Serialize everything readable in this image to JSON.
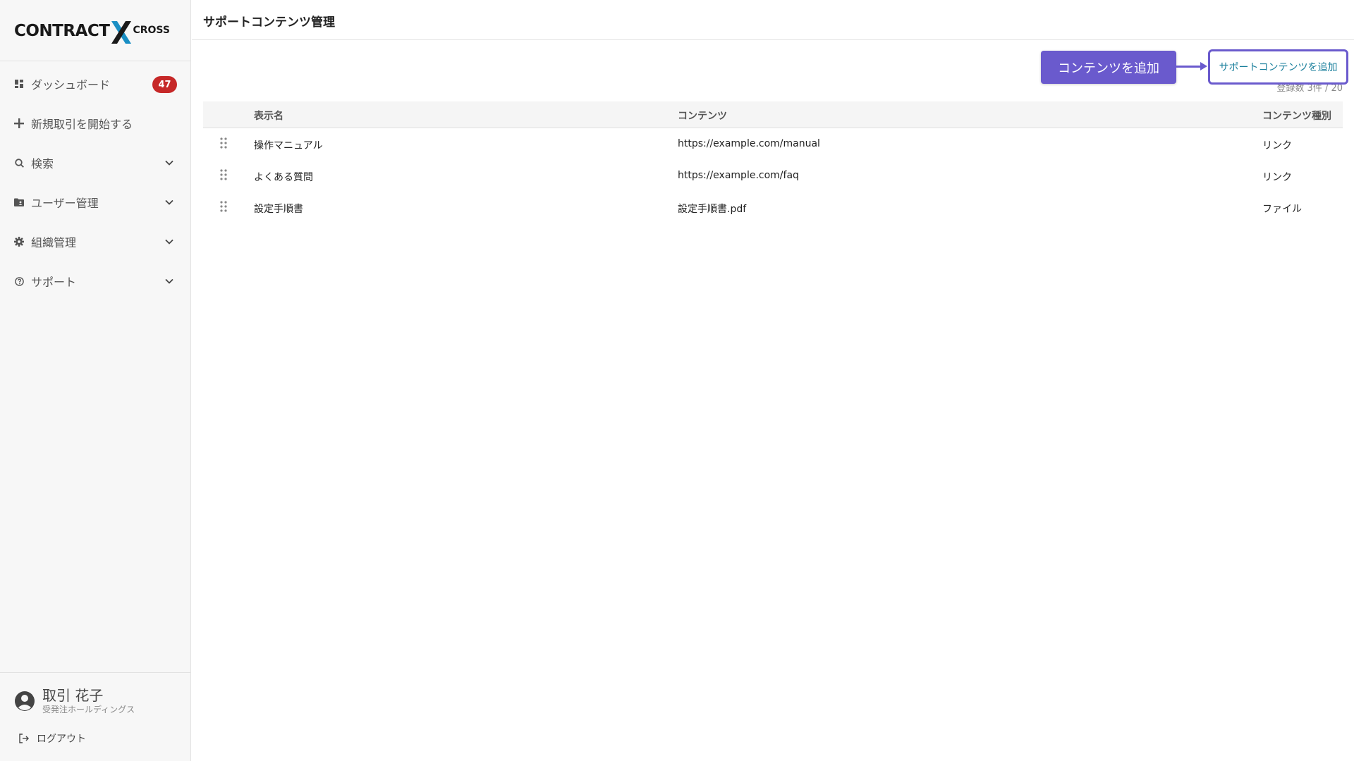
{
  "brand": {
    "logo_main": "CONTRACT",
    "logo_suffix": "CROSS"
  },
  "sidebar": {
    "items": [
      {
        "label": "ダッシュボード",
        "icon": "dashboard-icon",
        "badge": "47"
      },
      {
        "label": "新規取引を開始する",
        "icon": "plus-icon"
      },
      {
        "label": "検索",
        "icon": "search-icon",
        "expandable": true
      },
      {
        "label": "ユーザー管理",
        "icon": "folder-user-icon",
        "expandable": true
      },
      {
        "label": "組織管理",
        "icon": "gear-icon",
        "expandable": true
      },
      {
        "label": "サポート",
        "icon": "help-circle-icon",
        "expandable": true
      }
    ],
    "user": {
      "name": "取引 花子",
      "org": "受発注ホールディングス"
    },
    "logout_label": "ログアウト"
  },
  "header": {
    "title": "サポートコンテンツ管理"
  },
  "toolbar": {
    "callout_label": "コンテンツを追加",
    "add_button_label": "サポートコンテンツを追加",
    "count_text": "登録数 3件 / 20"
  },
  "table": {
    "columns": [
      "表示名",
      "コンテンツ",
      "コンテンツ種別"
    ],
    "rows": [
      {
        "name": "操作マニュアル",
        "content": "https://example.com/manual",
        "type": "リンク"
      },
      {
        "name": "よくある質問",
        "content": "https://example.com/faq",
        "type": "リンク"
      },
      {
        "name": "設定手順書",
        "content": "設定手順書.pdf",
        "type": "ファイル"
      }
    ]
  },
  "colors": {
    "accent": "#6a5acd",
    "badge": "#c62828",
    "link_text": "#1a7f9c",
    "logo_x": "#1a8fc4"
  }
}
